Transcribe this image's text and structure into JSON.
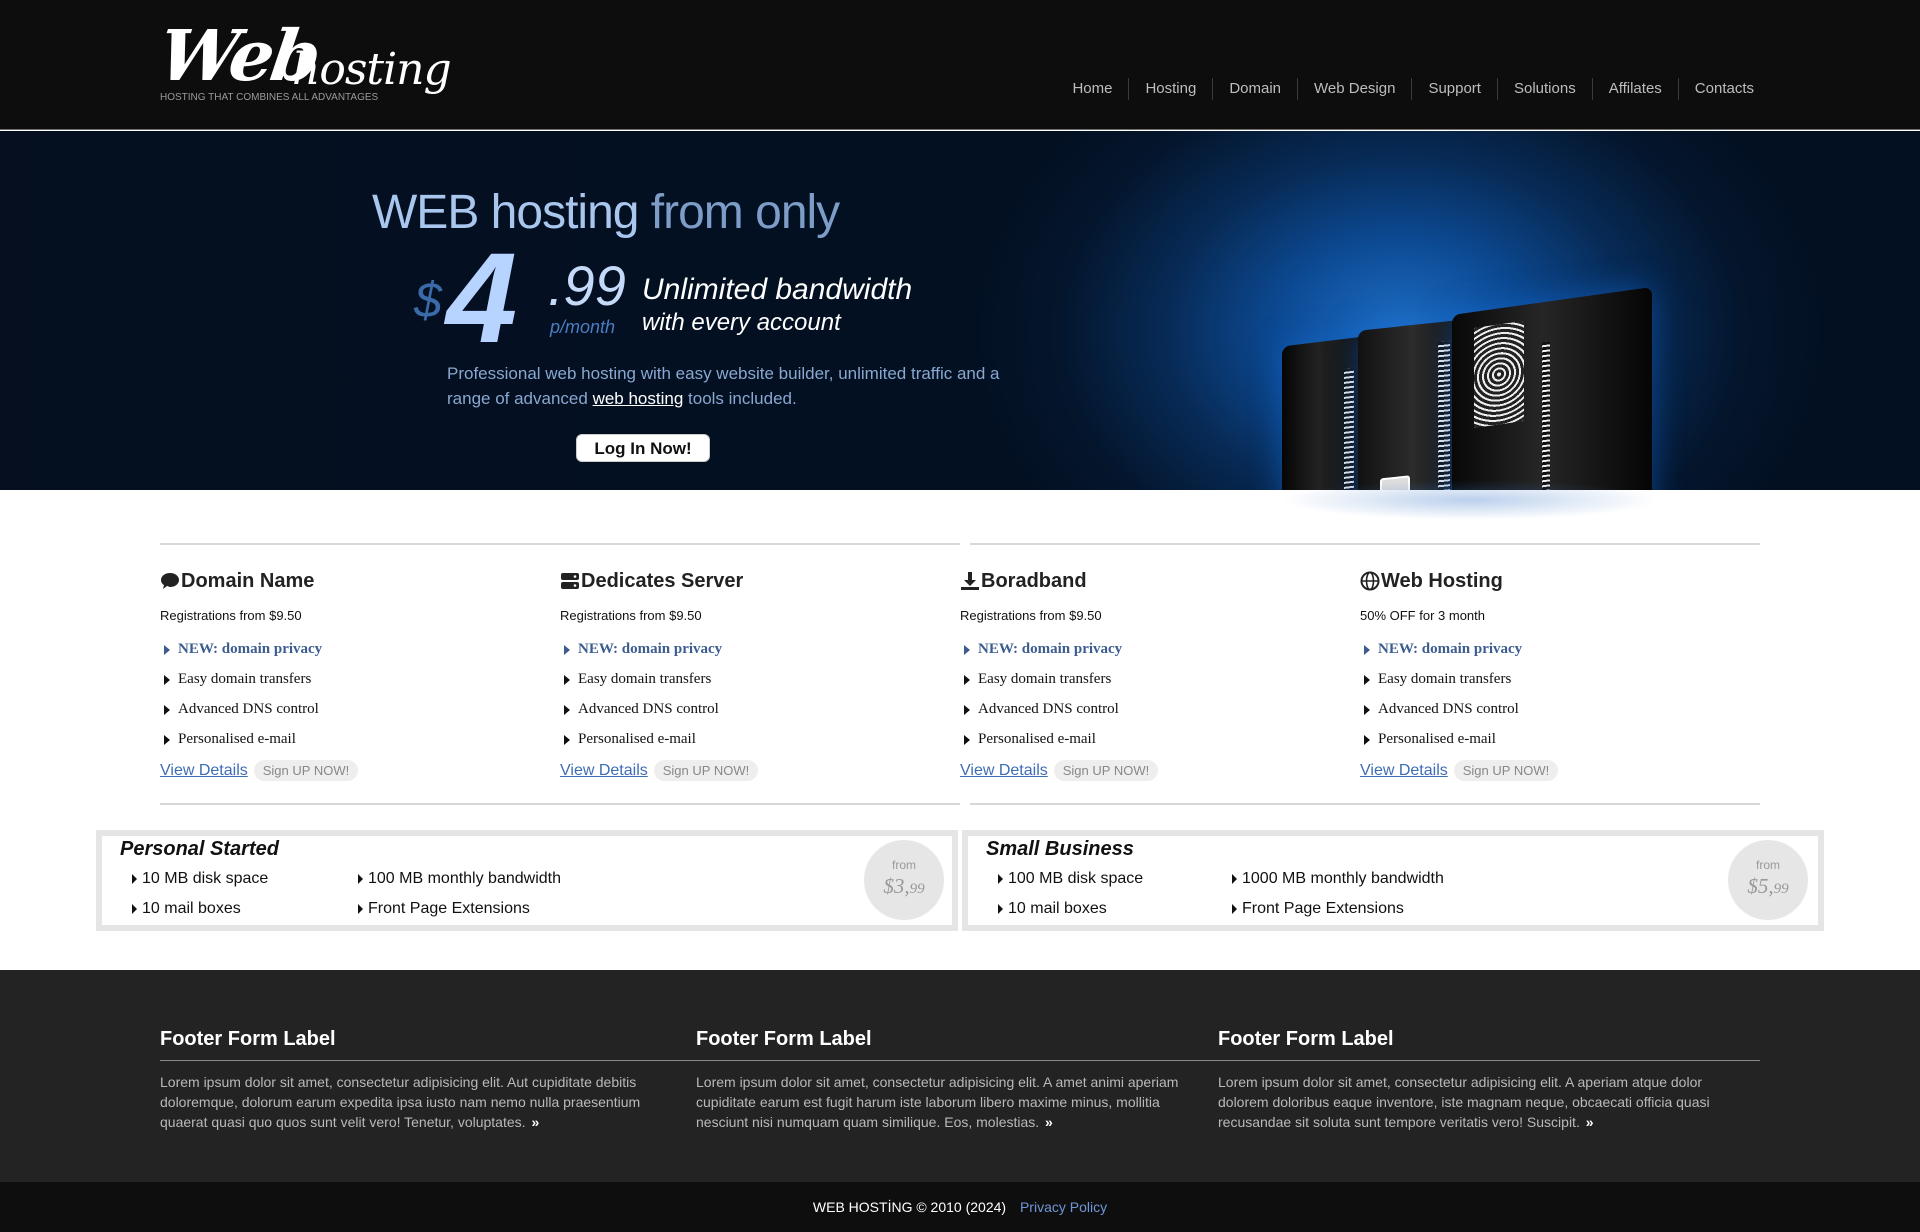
{
  "header": {
    "logo_web": "Web",
    "logo_hosting": "hosting",
    "tagline": "HOSTING THAT COMBINES ALL ADVANTAGES",
    "nav": [
      "Home",
      "Hosting",
      "Domain",
      "Web Design",
      "Support",
      "Solutions",
      "Affilates",
      "Contacts"
    ]
  },
  "hero": {
    "headline_a": "WEB hosting",
    "headline_b": " from only",
    "price_dollar": "$",
    "price_int": "4",
    "price_cents": ".99",
    "price_per": "p/month",
    "tag1": "Unlimited bandwidth",
    "tag2": "with every account",
    "desc_before": "Professional web hosting with easy website builder, unlimited traffic and a range of advanced ",
    "desc_link": "web hosting",
    "desc_after": " tools included.",
    "button": "Log In Now!"
  },
  "features": [
    {
      "icon": "chat-bubble-icon",
      "title": "Domain Name",
      "subtitle": "Registrations from $9.50",
      "items": [
        "NEW: domain privacy",
        "Easy domain transfers",
        "Advanced DNS control",
        "Personalised e-mail"
      ],
      "details": "View Details",
      "signup": "Sign UP NOW!"
    },
    {
      "icon": "server-icon",
      "title": "Dedicates Server",
      "subtitle": "Registrations from $9.50",
      "items": [
        "NEW: domain privacy",
        "Easy domain transfers",
        "Advanced DNS control",
        "Personalised e-mail"
      ],
      "details": "View Details",
      "signup": "Sign UP NOW!"
    },
    {
      "icon": "download-icon",
      "title": "Boradband",
      "subtitle": "Registrations from $9.50",
      "items": [
        "NEW: domain privacy",
        "Easy domain transfers",
        "Advanced DNS control",
        "Personalised e-mail"
      ],
      "details": "View Details",
      "signup": "Sign UP NOW!"
    },
    {
      "icon": "globe-icon",
      "title": "Web Hosting",
      "subtitle": "50% OFF for 3 month",
      "items": [
        "NEW: domain privacy",
        "Easy domain transfers",
        "Advanced DNS control",
        "Personalised e-mail"
      ],
      "details": "View Details",
      "signup": "Sign UP NOW!"
    }
  ],
  "plans": [
    {
      "name": "Personal Started",
      "items": [
        "10 MB disk space",
        "100 MB monthly bandwidth",
        "10 mail boxes",
        "Front Page Extensions"
      ],
      "from": "from",
      "price": "$3,",
      "cents": "99"
    },
    {
      "name": "Small Business",
      "items": [
        "100 MB disk space",
        "1000 MB monthly bandwidth",
        "10 mail boxes",
        "Front Page Extensions"
      ],
      "from": "from",
      "price": "$5,",
      "cents": "99"
    }
  ],
  "footer": {
    "columns": [
      {
        "title": "Footer Form Label",
        "text": "Lorem ipsum dolor sit amet, consectetur adipisicing elit. Aut cupiditate debitis doloremque, dolorum earum expedita ipsa iusto nam nemo nulla praesentium quaerat quasi quo quos sunt velit vero! Tenetur, voluptates."
      },
      {
        "title": "Footer Form Label",
        "text": "Lorem ipsum dolor sit amet, consectetur adipisicing elit. A amet animi aperiam cupiditate earum est fugit harum iste laborum libero maxime minus, mollitia nesciunt nisi numquam quam similique. Eos, molestias."
      },
      {
        "title": "Footer Form Label",
        "text": "Lorem ipsum dolor sit amet, consectetur adipisicing elit. A aperiam atque dolor dolorem doloribus eaque inventore, iste magnam neque, obcaecati officia quasi recusandae sit soluta sunt tempore veritatis vero! Suscipit."
      }
    ],
    "more_glyph": "»",
    "copyright": "WEB HOSTİNG © 2010 (2024)",
    "privacy": "Privacy Policy"
  },
  "colors": {
    "accent_link": "#3d6db5",
    "highlight_item": "#3d5d8f",
    "header_bg": "#0d0d0d",
    "footer_bg": "#232323"
  }
}
